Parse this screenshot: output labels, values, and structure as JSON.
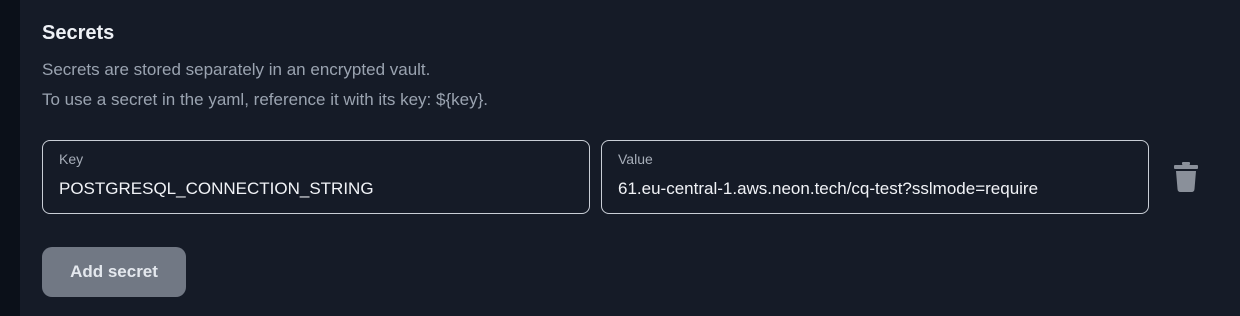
{
  "secrets": {
    "title": "Secrets",
    "description_line1": "Secrets are stored separately in an encrypted vault.",
    "description_line2": "To use a secret in the yaml, reference it with its key: ${key}.",
    "entries": [
      {
        "key_label": "Key",
        "key_value": "POSTGRESQL_CONNECTION_STRING",
        "value_label": "Value",
        "value_value": "61.eu-central-1.aws.neon.tech/cq-test?sslmode=require"
      }
    ],
    "delete_icon": "trash-icon",
    "add_button_label": "Add secret"
  },
  "colors": {
    "panel_background": "#151b27",
    "page_background": "#0b1019",
    "field_border": "#c9ced6",
    "button_background": "#717884",
    "icon_color": "#8a909a"
  }
}
